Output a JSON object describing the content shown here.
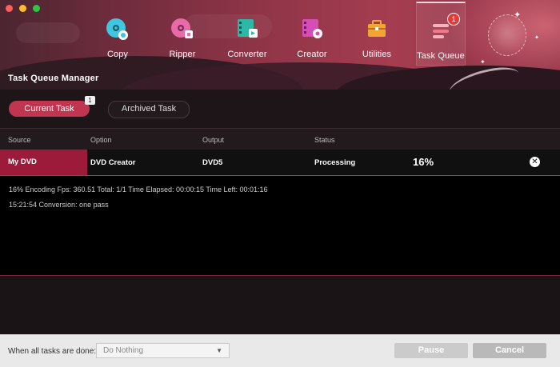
{
  "window": {
    "controls": [
      "close",
      "minimize",
      "zoom"
    ]
  },
  "nav": {
    "items": [
      {
        "label": "Copy",
        "icon": "disc-copy-icon",
        "color": "#3fc6e0"
      },
      {
        "label": "Ripper",
        "icon": "disc-ripper-icon",
        "color": "#e86aa8"
      },
      {
        "label": "Converter",
        "icon": "film-converter-icon",
        "color": "#2fb7a6"
      },
      {
        "label": "Creator",
        "icon": "film-creator-icon",
        "color": "#d64db8"
      },
      {
        "label": "Utilities",
        "icon": "toolbox-icon",
        "color": "#f0a535"
      },
      {
        "label": "Task Queue",
        "icon": "task-queue-icon",
        "color": "#f07a8a",
        "badge": "1",
        "active": true
      }
    ]
  },
  "header": {
    "title": "Task Queue Manager"
  },
  "tabs": {
    "current": "Current Task",
    "current_count": "1",
    "archived": "Archived Task"
  },
  "table": {
    "columns": [
      "Source",
      "Option",
      "Output",
      "Status"
    ],
    "row": {
      "source": "My DVD",
      "option": "DVD Creator",
      "output": "DVD5",
      "status": "Processing",
      "progress": "16%"
    }
  },
  "log": {
    "line1": "16%  Encoding Fps: 360.51   Total: 1/1   Time Elapsed: 00:00:15   Time Left: 00:01:16",
    "line2": "15:21:54    Conversion: one pass"
  },
  "footer": {
    "label": "When all tasks are done:",
    "select_value": "Do Nothing",
    "pause": "Pause",
    "cancel": "Cancel"
  },
  "colors": {
    "accent": "#c23550",
    "source_bg": "#9c1b3a"
  }
}
